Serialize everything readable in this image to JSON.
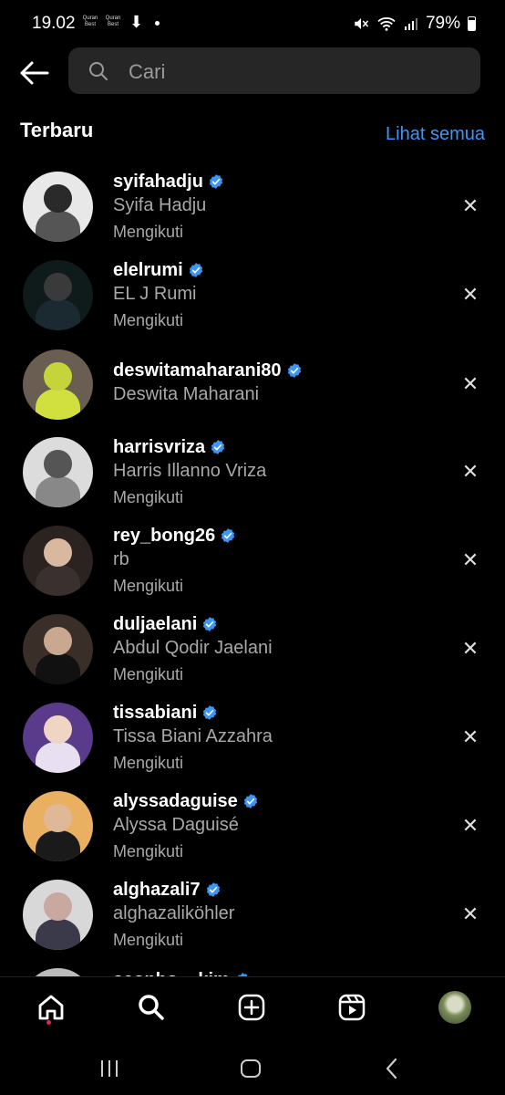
{
  "status_bar": {
    "time": "19.02",
    "app_badge_1": "Quran Best",
    "app_badge_2": "Quran Best",
    "battery": "79%"
  },
  "search": {
    "placeholder": "Cari"
  },
  "recent": {
    "title": "Terbaru",
    "see_all": "Lihat semua",
    "items": [
      {
        "username": "syifahadju",
        "name": "Syifa Hadju",
        "status": "Mengikuti"
      },
      {
        "username": "elelrumi",
        "name": "EL J Rumi",
        "status": "Mengikuti"
      },
      {
        "username": "deswitamaharani80",
        "name": "Deswita Maharani",
        "status": ""
      },
      {
        "username": "harrisvriza",
        "name": "Harris Illanno Vriza",
        "status": "Mengikuti"
      },
      {
        "username": "rey_bong26",
        "name": "rb",
        "status": "Mengikuti"
      },
      {
        "username": "duljaelani",
        "name": "Abdul Qodir Jaelani",
        "status": "Mengikuti"
      },
      {
        "username": "tissabiani",
        "name": "Tissa Biani Azzahra",
        "status": "Mengikuti"
      },
      {
        "username": "alyssadaguise",
        "name": "Alyssa Daguisé",
        "status": "Mengikuti"
      },
      {
        "username": "alghazali7",
        "name": "alghazaliköhler",
        "status": "Mengikuti"
      },
      {
        "username": "seonho__kim",
        "name": "",
        "status": ""
      }
    ]
  },
  "colors": {
    "accent": "#3d96f2",
    "verified": "#3d96f2",
    "background": "#000000",
    "search_bg": "#262626",
    "secondary_text": "#a8a8a8"
  },
  "icons": {
    "back": "arrow-left-icon",
    "search": "search-icon",
    "remove": "close-icon",
    "verified": "verified-badge-icon",
    "nav": [
      "home-icon",
      "search-icon",
      "create-post-icon",
      "reels-icon",
      "profile-avatar"
    ]
  }
}
